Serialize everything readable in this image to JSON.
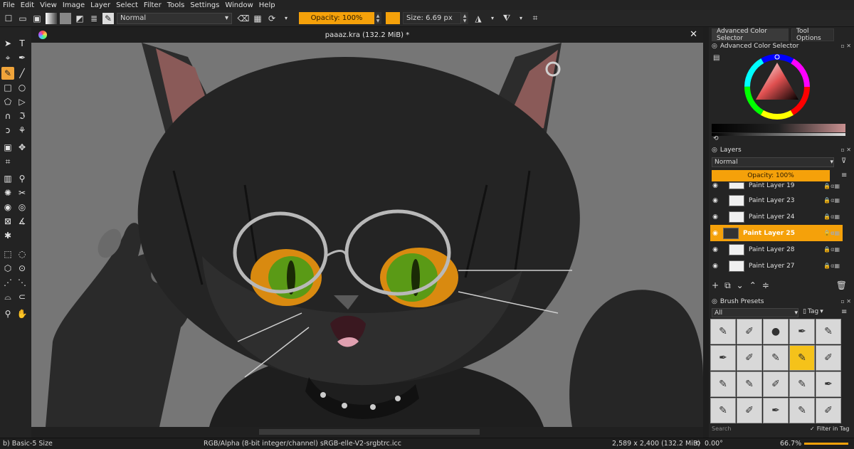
{
  "menu": [
    "File",
    "Edit",
    "View",
    "Image",
    "Layer",
    "Select",
    "Filter",
    "Tools",
    "Settings",
    "Window",
    "Help"
  ],
  "toolbar": {
    "blend_mode": "Normal",
    "opacity": "Opacity: 100%",
    "size": "Size: 6.69 px",
    "accent": "#f5a10a"
  },
  "document": {
    "title": "paaaz.kra (132.2 MiB) *"
  },
  "dock": {
    "tabs": [
      "Advanced Color Selector",
      "Tool Options"
    ],
    "color_selector_title": "Advanced Color Selector",
    "layers": {
      "title": "Layers",
      "blend_mode": "Normal",
      "opacity": "Opacity:  100%",
      "items": [
        {
          "name": "Paint Layer 19",
          "active": false
        },
        {
          "name": "Paint Layer 23",
          "active": false
        },
        {
          "name": "Paint Layer 24",
          "active": false
        },
        {
          "name": "Paint Layer 25",
          "active": true
        },
        {
          "name": "Paint Layer 28",
          "active": false
        },
        {
          "name": "Paint Layer 27",
          "active": false
        }
      ]
    },
    "brush_presets": {
      "title": "Brush Presets",
      "filter": "All",
      "tag": "Tag",
      "search_placeholder": "Search",
      "filter_in_tag": "Filter in Tag"
    }
  },
  "status": {
    "brush": "b) Basic-5 Size",
    "color_profile": "RGB/Alpha (8-bit integer/channel)  sRGB-elle-V2-srgbtrc.icc",
    "dimensions": "2,589 x 2,400 (132.2 MiB)",
    "rotation": "0.00°",
    "zoom": "66.7%"
  }
}
